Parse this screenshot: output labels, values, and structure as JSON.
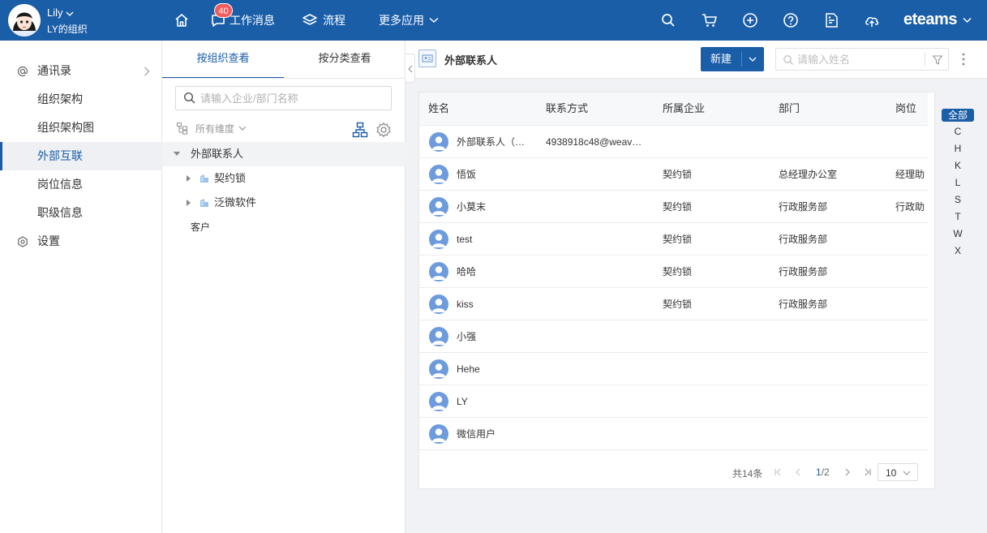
{
  "header": {
    "user_name": "Lily",
    "org_name": "LY的组织",
    "badge_count": "40",
    "nav": [
      {
        "label": ""
      },
      {
        "label": "工作消息"
      },
      {
        "label": "流程"
      },
      {
        "label": "更多应用"
      }
    ],
    "brand": "eteams"
  },
  "sidebar": {
    "items": [
      {
        "label": "通讯录"
      },
      {
        "label": "组织架构"
      },
      {
        "label": "组织架构图"
      },
      {
        "label": "外部互联"
      },
      {
        "label": "岗位信息"
      },
      {
        "label": "职级信息"
      },
      {
        "label": "设置"
      }
    ]
  },
  "tree": {
    "tabs": [
      {
        "label": "按组织查看"
      },
      {
        "label": "按分类查看"
      }
    ],
    "search_placeholder": "请输入企业/部门名称",
    "dimension_label": "所有维度",
    "nodes": [
      {
        "label": "外部联系人"
      },
      {
        "label": "契约锁"
      },
      {
        "label": "泛微软件"
      },
      {
        "label": "客户"
      }
    ]
  },
  "content": {
    "title": "外部联系人",
    "new_button": "新建",
    "name_search_placeholder": "请输入姓名",
    "columns": [
      "姓名",
      "联系方式",
      "所属企业",
      "部门",
      "岗位"
    ],
    "rows": [
      {
        "name": "外部联系人（…",
        "contact": "4938918c48@weav…",
        "company": "",
        "dept": "",
        "post": ""
      },
      {
        "name": "悟饭",
        "contact": "",
        "company": "契约锁",
        "dept": "总经理办公室",
        "post": "经理助"
      },
      {
        "name": "小莫末",
        "contact": "",
        "company": "契约锁",
        "dept": "行政服务部",
        "post": "行政助"
      },
      {
        "name": "test",
        "contact": "",
        "company": "契约锁",
        "dept": "行政服务部",
        "post": ""
      },
      {
        "name": "哈哈",
        "contact": "",
        "company": "契约锁",
        "dept": "行政服务部",
        "post": ""
      },
      {
        "name": "kiss",
        "contact": "",
        "company": "契约锁",
        "dept": "行政服务部",
        "post": ""
      },
      {
        "name": "小强",
        "contact": "",
        "company": "",
        "dept": "",
        "post": ""
      },
      {
        "name": "Hehe",
        "contact": "",
        "company": "",
        "dept": "",
        "post": ""
      },
      {
        "name": "LY",
        "contact": "",
        "company": "",
        "dept": "",
        "post": ""
      },
      {
        "name": "微信用户",
        "contact": "",
        "company": "",
        "dept": "",
        "post": ""
      }
    ],
    "pager": {
      "total": "共14条",
      "current": "1",
      "sep_total": "/2",
      "page_size": "10"
    },
    "alphabet": [
      "全部",
      "C",
      "H",
      "K",
      "L",
      "S",
      "T",
      "W",
      "X"
    ]
  },
  "colors": {
    "primary": "#1a5ea8",
    "badge": "#f25c5c",
    "avatar": "#6d9bdc"
  }
}
